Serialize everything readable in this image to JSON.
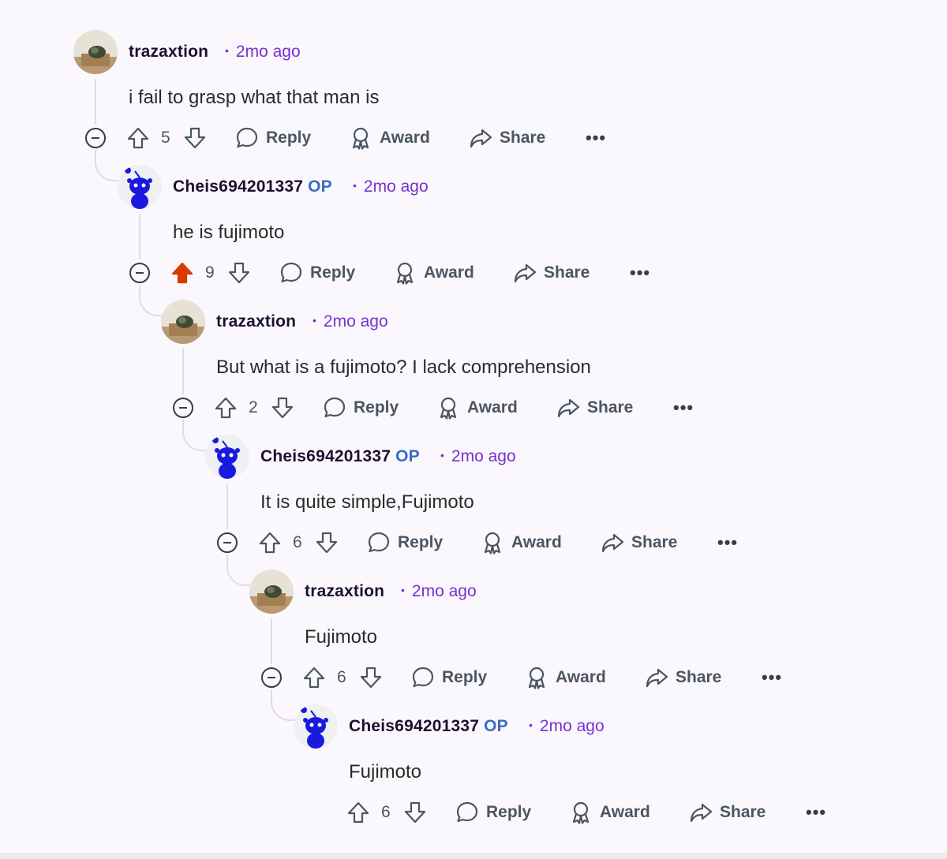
{
  "comments": [
    {
      "username": "trazaxtion",
      "is_op": false,
      "op_label": "",
      "age": "2mo ago",
      "avatar": "cat-in-box-avatar",
      "text": "i fail to grasp what that man is",
      "votes": "5",
      "upvoted": false,
      "reply_label": "Reply",
      "award_label": "Award",
      "share_label": "Share"
    },
    {
      "username": "Cheis694201337",
      "is_op": true,
      "op_label": "OP",
      "age": "2mo ago",
      "avatar": "snoo-avatar",
      "text": "he is fujimoto",
      "votes": "9",
      "upvoted": true,
      "reply_label": "Reply",
      "award_label": "Award",
      "share_label": "Share"
    },
    {
      "username": "trazaxtion",
      "is_op": false,
      "op_label": "",
      "age": "2mo ago",
      "avatar": "cat-in-box-avatar",
      "text": "But what is a fujimoto? I lack comprehension",
      "votes": "2",
      "upvoted": false,
      "reply_label": "Reply",
      "award_label": "Award",
      "share_label": "Share"
    },
    {
      "username": "Cheis694201337",
      "is_op": true,
      "op_label": "OP",
      "age": "2mo ago",
      "avatar": "snoo-avatar",
      "text": "It is quite simple,Fujimoto",
      "votes": "6",
      "upvoted": false,
      "reply_label": "Reply",
      "award_label": "Award",
      "share_label": "Share"
    },
    {
      "username": "trazaxtion",
      "is_op": false,
      "op_label": "",
      "age": "2mo ago",
      "avatar": "cat-in-box-avatar",
      "text": "Fujimoto",
      "votes": "6",
      "upvoted": false,
      "reply_label": "Reply",
      "award_label": "Award",
      "share_label": "Share"
    },
    {
      "username": "Cheis694201337",
      "is_op": true,
      "op_label": "OP",
      "age": "2mo ago",
      "avatar": "snoo-avatar",
      "text": "Fujimoto",
      "votes": "6",
      "upvoted": false,
      "reply_label": "Reply",
      "award_label": "Award",
      "share_label": "Share"
    }
  ],
  "more_label": "•••",
  "colors": {
    "background": "#faf8fc",
    "username": "#1c1030",
    "op_badge": "#3a6ac4",
    "timestamp": "#7a2fd0",
    "upvoted": "#d93a00",
    "thread_line": "#e3d8ee",
    "action_text": "#4b5563"
  }
}
